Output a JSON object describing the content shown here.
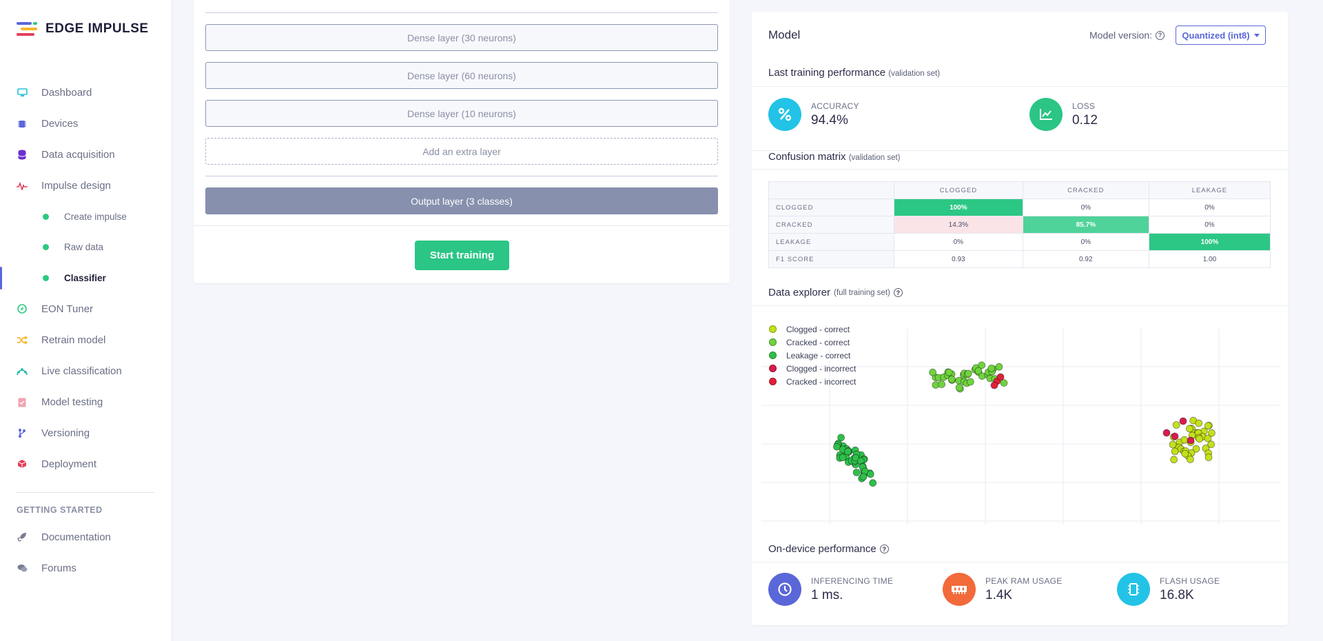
{
  "brand": {
    "name": "EDGE IMPULSE"
  },
  "nav": {
    "items": [
      {
        "label": "Dashboard",
        "icon": "monitor-icon"
      },
      {
        "label": "Devices",
        "icon": "chip-icon"
      },
      {
        "label": "Data acquisition",
        "icon": "database-icon"
      },
      {
        "label": "Impulse design",
        "icon": "pulse-icon"
      }
    ],
    "sub": [
      {
        "label": "Create impulse"
      },
      {
        "label": "Raw data"
      },
      {
        "label": "Classifier"
      }
    ],
    "items2": [
      {
        "label": "EON Tuner",
        "icon": "compass-icon"
      },
      {
        "label": "Retrain model",
        "icon": "shuffle-icon"
      },
      {
        "label": "Live classification",
        "icon": "live-icon"
      },
      {
        "label": "Model testing",
        "icon": "clipboard-check-icon"
      },
      {
        "label": "Versioning",
        "icon": "git-branch-icon"
      },
      {
        "label": "Deployment",
        "icon": "package-icon"
      }
    ],
    "section": "GETTING STARTED",
    "items3": [
      {
        "label": "Documentation",
        "icon": "rocket-icon"
      },
      {
        "label": "Forums",
        "icon": "chat-icon"
      }
    ]
  },
  "network": {
    "layers": [
      "Dense layer (30 neurons)",
      "Dense layer (60 neurons)",
      "Dense layer (10 neurons)"
    ],
    "extra": "Add an extra layer",
    "output": "Output layer (3 classes)",
    "train_button": "Start training"
  },
  "model": {
    "title": "Model",
    "version_label": "Model version:",
    "version_value": "Quantized (int8)",
    "last_training": {
      "title": "Last training performance",
      "subtitle": "(validation set)"
    },
    "accuracy": {
      "label": "ACCURACY",
      "value": "94.4%"
    },
    "loss": {
      "label": "LOSS",
      "value": "0.12"
    },
    "confusion": {
      "title": "Confusion matrix",
      "subtitle": "(validation set)",
      "columns": [
        "CLOGGED",
        "CRACKED",
        "LEAKAGE"
      ],
      "rows": [
        {
          "label": "CLOGGED",
          "cells": [
            "100%",
            "0%",
            "0%"
          ]
        },
        {
          "label": "CRACKED",
          "cells": [
            "14.3%",
            "85.7%",
            "0%"
          ]
        },
        {
          "label": "LEAKAGE",
          "cells": [
            "0%",
            "0%",
            "100%"
          ]
        },
        {
          "label": "F1 SCORE",
          "cells": [
            "0.93",
            "0.92",
            "1.00"
          ]
        }
      ]
    },
    "explorer": {
      "title": "Data explorer",
      "subtitle": "(full training set)",
      "legend": [
        {
          "label": "Clogged - correct",
          "color": "#c5e01b"
        },
        {
          "label": "Cracked - correct",
          "color": "#6fd33d"
        },
        {
          "label": "Leakage - correct",
          "color": "#2fc04a"
        },
        {
          "label": "Clogged - incorrect",
          "color": "#d81b4f"
        },
        {
          "label": "Cracked - incorrect",
          "color": "#e02038"
        }
      ]
    },
    "on_device": {
      "title": "On-device performance",
      "inferencing": {
        "label": "INFERENCING TIME",
        "value": "1 ms."
      },
      "ram": {
        "label": "PEAK RAM USAGE",
        "value": "1.4K"
      },
      "flash": {
        "label": "FLASH USAGE",
        "value": "16.8K"
      }
    }
  }
}
